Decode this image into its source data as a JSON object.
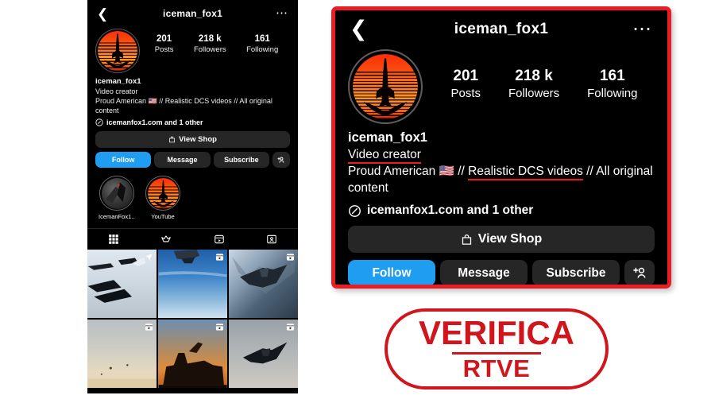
{
  "profile": {
    "header": {
      "title": "iceman_fox1",
      "back_icon": "back-chevron-icon",
      "menu_icon": "more-options-icon"
    },
    "avatar": {
      "icon": "profile-avatar-fighter-jet-sunset"
    },
    "stats": [
      {
        "num": "201",
        "label": "Posts"
      },
      {
        "num": "218 k",
        "label": "Followers"
      },
      {
        "num": "161",
        "label": "Following"
      }
    ],
    "bio": {
      "name": "iceman_fox1",
      "category": "Video creator",
      "line_before": "Proud American ",
      "flag": "🇺🇸",
      "sep1": " // ",
      "highlight": "Realistic DCS videos",
      "line_after": " // All original content",
      "link_icon": "link-icon",
      "link_text": "icemanfox1.com and 1 other"
    },
    "buttons": {
      "shop_icon": "shop-bag-icon",
      "shop": "View Shop",
      "follow": "Follow",
      "message": "Message",
      "subscribe": "Subscribe",
      "add_person_icon": "add-person-icon"
    },
    "highlights": [
      {
        "label": "IcemanFox1..."
      },
      {
        "label": "YouTube"
      }
    ],
    "tabs": [
      {
        "icon": "grid-tab-icon"
      },
      {
        "icon": "shop-tab-icon"
      },
      {
        "icon": "reels-tab-icon"
      },
      {
        "icon": "tagged-tab-icon"
      }
    ],
    "grid": [
      {
        "name": "post-jets-formation-sky",
        "reel": false
      },
      {
        "name": "post-stealth-jet-blue-sky",
        "reel": true
      },
      {
        "name": "post-b2-bomber-over-snow",
        "reel": true
      },
      {
        "name": "post-hazy-desert-sky",
        "reel": true
      },
      {
        "name": "post-f15-sunset-silhouette",
        "reel": true
      },
      {
        "name": "post-b2-bomber-grey-sky",
        "reel": true
      }
    ]
  },
  "logo": {
    "main": "VERIFICA",
    "sub": "RTVE"
  },
  "colors": {
    "accent_red": "#ec1c24",
    "logo_red": "#d0161c",
    "follow_blue": "#1f9df0",
    "button_grey": "#262626",
    "background": "#000000"
  }
}
